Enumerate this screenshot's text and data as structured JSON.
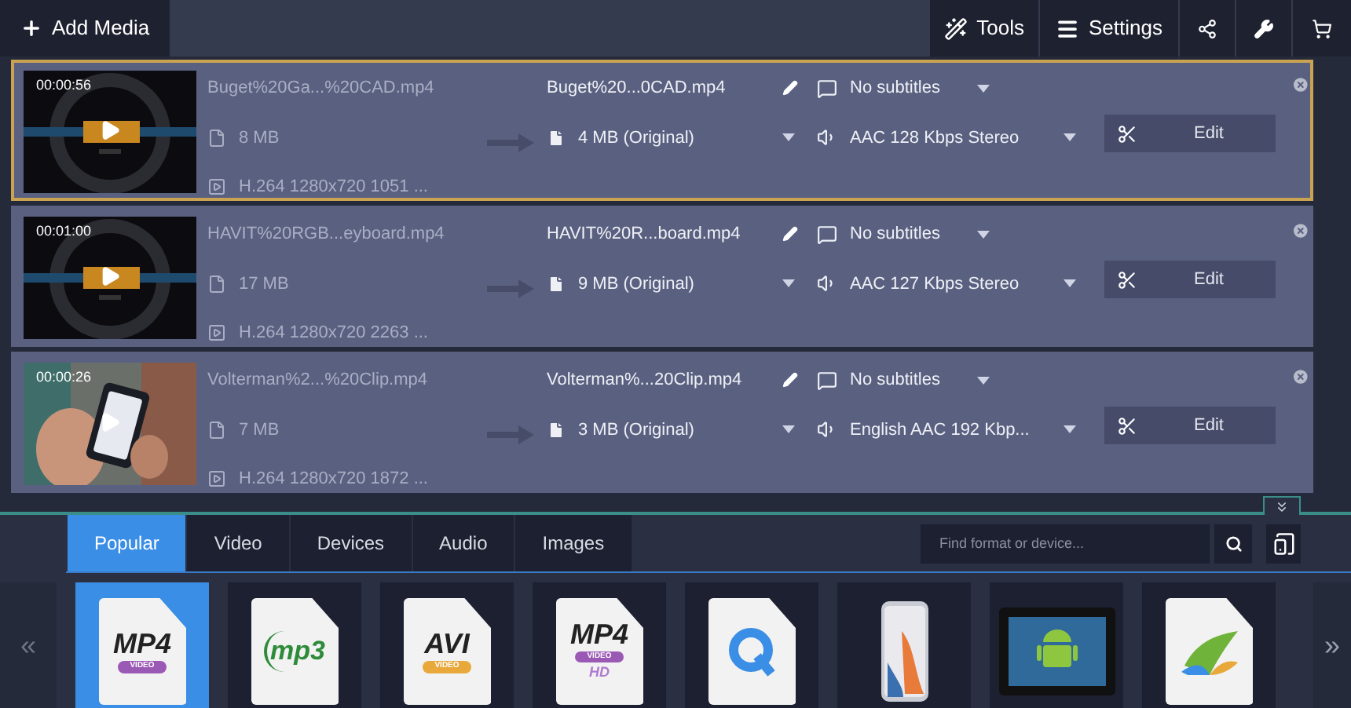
{
  "toolbar": {
    "add_media": "Add Media",
    "tools": "Tools",
    "settings": "Settings"
  },
  "files": [
    {
      "selected": true,
      "duration": "00:00:56",
      "source_name": "Buget%20Ga...%20CAD.mp4",
      "source_size": "8 MB",
      "codec": "H.264 1280x720 1051 ...",
      "target_name": "Buget%20...0CAD.mp4",
      "target_size": "4 MB (Original)",
      "subtitles": "No subtitles",
      "audio": "AAC 128 Kbps Stereo",
      "edit": "Edit"
    },
    {
      "selected": false,
      "duration": "00:01:00",
      "source_name": "HAVIT%20RGB...eyboard.mp4",
      "source_size": "17 MB",
      "codec": "H.264 1280x720 2263 ...",
      "target_name": "HAVIT%20R...board.mp4",
      "target_size": "9 MB (Original)",
      "subtitles": "No subtitles",
      "audio": "AAC 127 Kbps Stereo",
      "edit": "Edit"
    },
    {
      "selected": false,
      "duration": "00:00:26",
      "source_name": "Volterman%2...%20Clip.mp4",
      "source_size": "7 MB",
      "codec": "H.264 1280x720 1872 ...",
      "target_name": "Volterman%...20Clip.mp4",
      "target_size": "3 MB (Original)",
      "subtitles": "No subtitles",
      "audio": "English AAC 192 Kbp...",
      "edit": "Edit"
    }
  ],
  "format_tabs": [
    {
      "label": "Popular",
      "selected": true
    },
    {
      "label": "Video",
      "selected": false
    },
    {
      "label": "Devices",
      "selected": false
    },
    {
      "label": "Audio",
      "selected": false
    },
    {
      "label": "Images",
      "selected": false
    }
  ],
  "search": {
    "placeholder": "Find format or device..."
  },
  "nav": {
    "prev": "«",
    "next": "»"
  },
  "formats": [
    {
      "kind": "file",
      "label": "MP4",
      "band": "VIDEO",
      "color": "#9b59b6",
      "selected": true
    },
    {
      "kind": "mp3",
      "label": "mp3",
      "selected": false
    },
    {
      "kind": "file",
      "label": "AVI",
      "band": "VIDEO",
      "color": "#e8a83a",
      "selected": false
    },
    {
      "kind": "file",
      "label": "MP4",
      "band": "VIDEO",
      "extra": "HD",
      "color": "#9b59b6",
      "selected": false
    },
    {
      "kind": "quicktime",
      "selected": false
    },
    {
      "kind": "phone",
      "selected": false
    },
    {
      "kind": "android",
      "selected": false
    },
    {
      "kind": "wmv",
      "selected": false
    }
  ]
}
